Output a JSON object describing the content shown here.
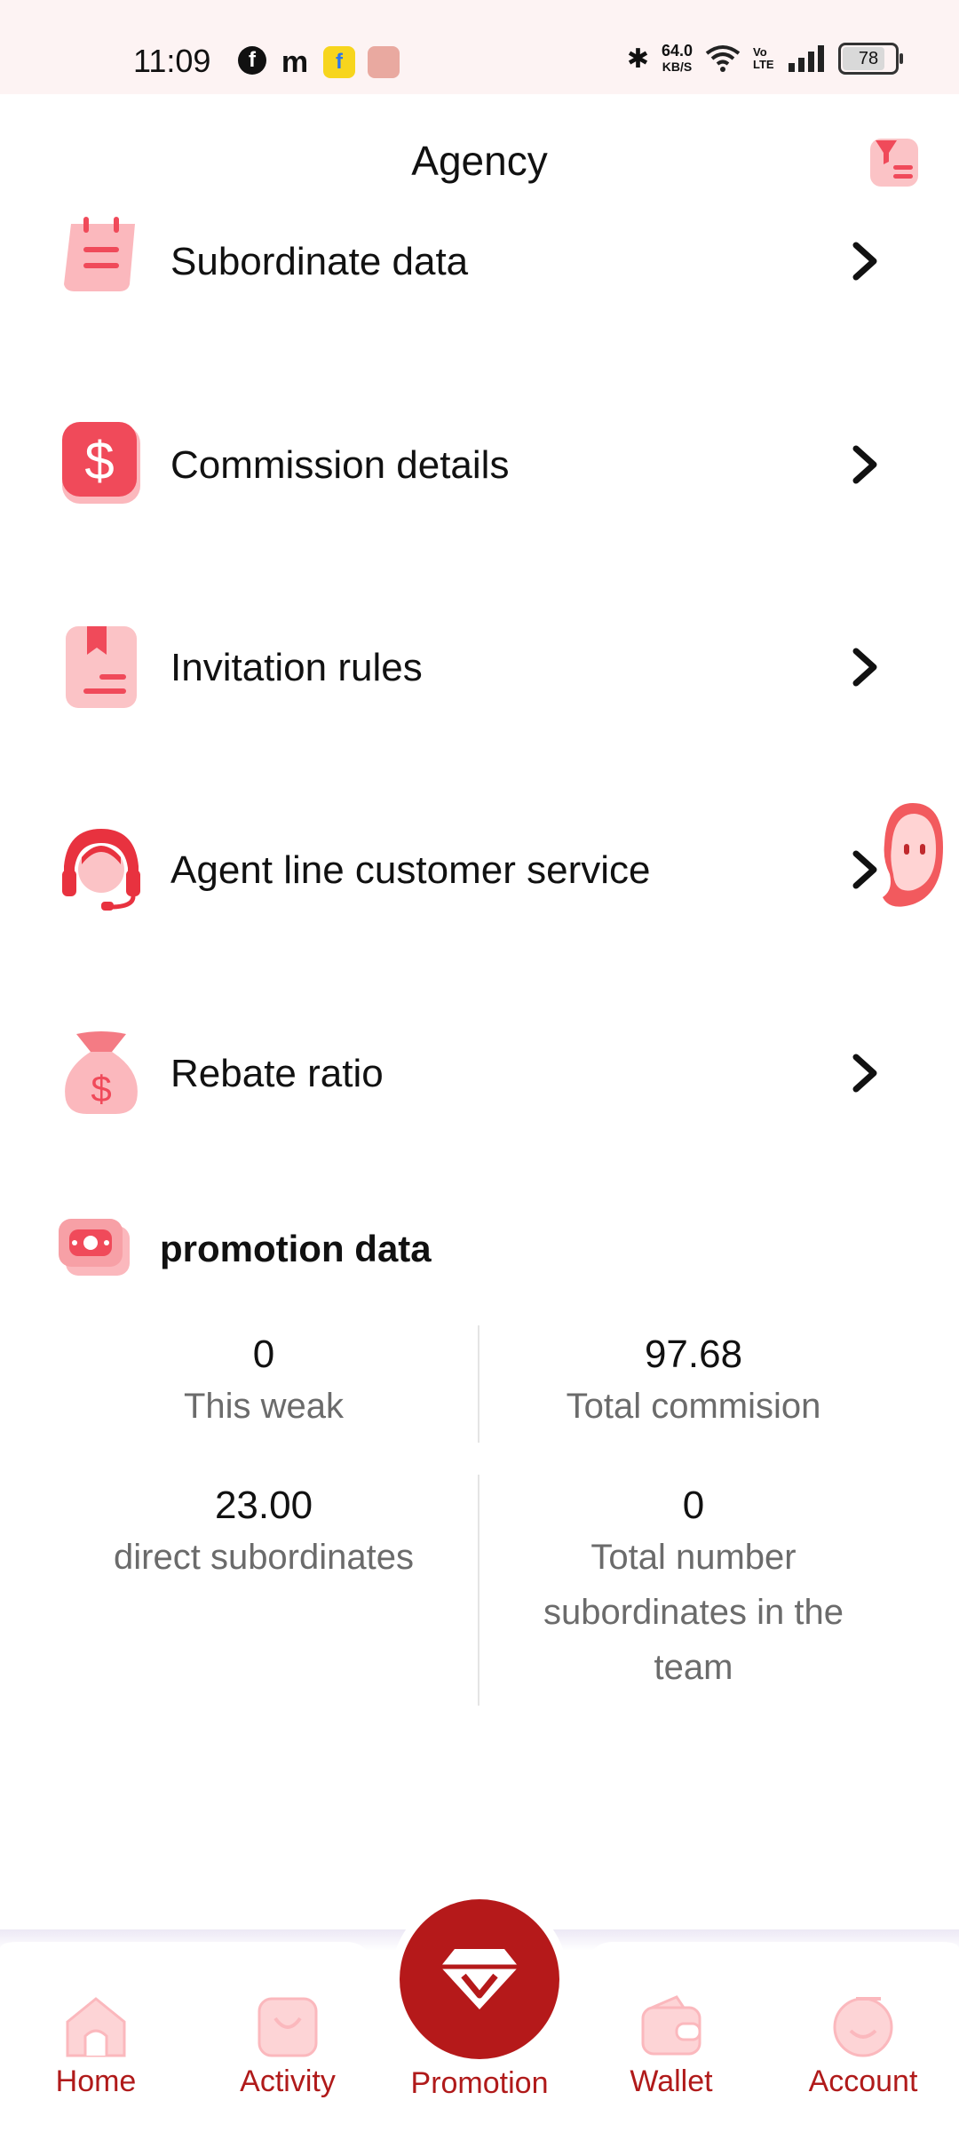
{
  "status_bar": {
    "time": "11:09",
    "speed_value": "64.0",
    "speed_unit": "KB/S",
    "volte": "Vo LTE",
    "battery": "78"
  },
  "header": {
    "title": "Agency"
  },
  "menu": [
    {
      "label": "Subordinate data",
      "icon": "clipboard-icon"
    },
    {
      "label": "Commission details",
      "icon": "dollar-icon"
    },
    {
      "label": "Invitation rules",
      "icon": "document-icon"
    },
    {
      "label": "Agent line customer service",
      "icon": "headset-icon"
    },
    {
      "label": "Rebate ratio",
      "icon": "money-bag-icon"
    }
  ],
  "promotion": {
    "title": "promotion data",
    "stats": [
      {
        "value": "0",
        "label": "This weak"
      },
      {
        "value": "97.68",
        "label": "Total commision"
      },
      {
        "value": "23.00",
        "label": "direct subordinates"
      },
      {
        "value": "0",
        "label": "Total number subordinates in the team"
      }
    ]
  },
  "nav": {
    "home": "Home",
    "activity": "Activity",
    "promotion": "Promotion",
    "wallet": "Wallet",
    "account": "Account"
  },
  "colors": {
    "accent": "#b5191a",
    "icon_pink": "#f47b84",
    "status_bg": "#fdf3f3"
  }
}
